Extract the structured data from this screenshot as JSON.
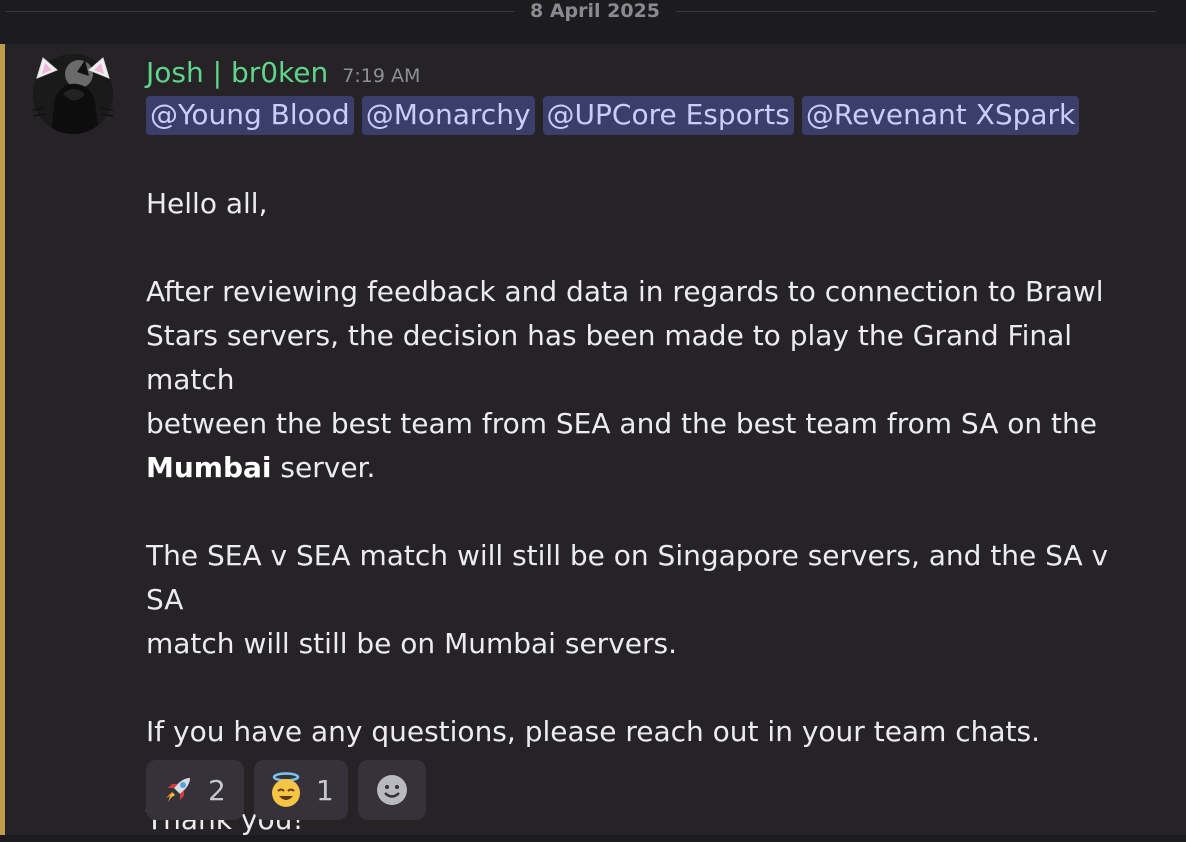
{
  "date_divider": "8 April 2025",
  "message": {
    "author": "Josh | br0ken",
    "timestamp": "7:19 AM",
    "mentions": [
      "@Young Blood",
      "@Monarchy",
      "@UPCore Esports",
      "@Revenant XSpark"
    ],
    "paragraphs": {
      "greeting": "Hello all,",
      "p2_line1": "After reviewing feedback and data in regards to connection to Brawl",
      "p2_line2": "Stars servers, the decision has been made to play the Grand Final match",
      "p2_line3": "between the best team from SEA and the best team from SA on the",
      "p2_bold": "Mumbai",
      "p2_tail": " server.",
      "p3_line1": "The SEA v SEA match will still be on Singapore servers, and the SA v SA",
      "p3_line2": "match will still be on Mumbai servers.",
      "p4": "If you have any questions, please reach out in your team chats.",
      "closing": "Thank you!"
    },
    "reactions": [
      {
        "icon": "rocket-icon",
        "count": "2"
      },
      {
        "icon": "smiling-face-with-halo-icon",
        "count": "1"
      }
    ],
    "add_reaction_icon": "add-reaction-icon"
  },
  "colors": {
    "username": "#5fd48a",
    "mention_bg": "#3b3d6b",
    "accent_bar": "#c09a4f"
  }
}
